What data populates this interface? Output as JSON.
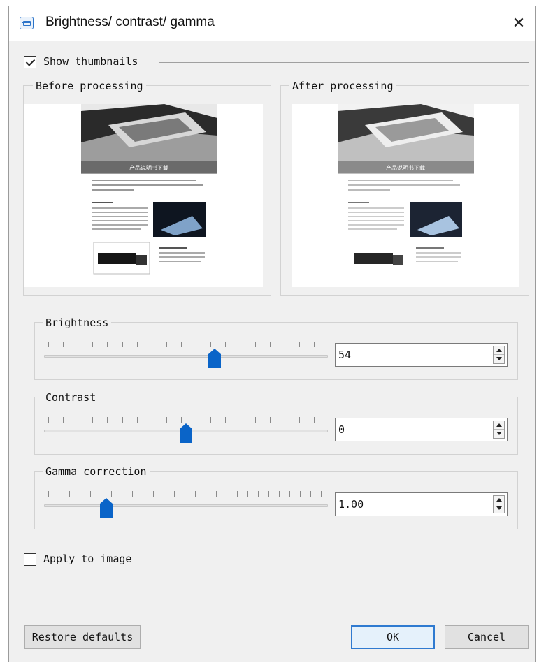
{
  "window": {
    "title": "Brightness/ contrast/ gamma",
    "close_glyph": "✕"
  },
  "thumbnails": {
    "show_label": "Show thumbnails",
    "show_checked": true,
    "before_label": "Before processing",
    "after_label": "After processing",
    "banner_text": "产品说明书下载"
  },
  "brightness": {
    "label": "Brightness",
    "value": "54",
    "slider_fraction": 0.6
  },
  "contrast": {
    "label": "Contrast",
    "value": "0",
    "slider_fraction": 0.5
  },
  "gamma": {
    "label": "Gamma correction",
    "value": "1.00",
    "slider_fraction": 0.22
  },
  "apply": {
    "label": "Apply to image",
    "checked": false
  },
  "buttons": {
    "restore": "Restore defaults",
    "ok": "OK",
    "cancel": "Cancel"
  },
  "colors": {
    "accent": "#0a64c8",
    "window_bg": "#f0f0f0"
  },
  "icons": [
    "dialog-icon",
    "close-icon",
    "checkbox-icon",
    "spin-up-icon",
    "spin-down-icon",
    "slider-thumb-icon"
  ]
}
